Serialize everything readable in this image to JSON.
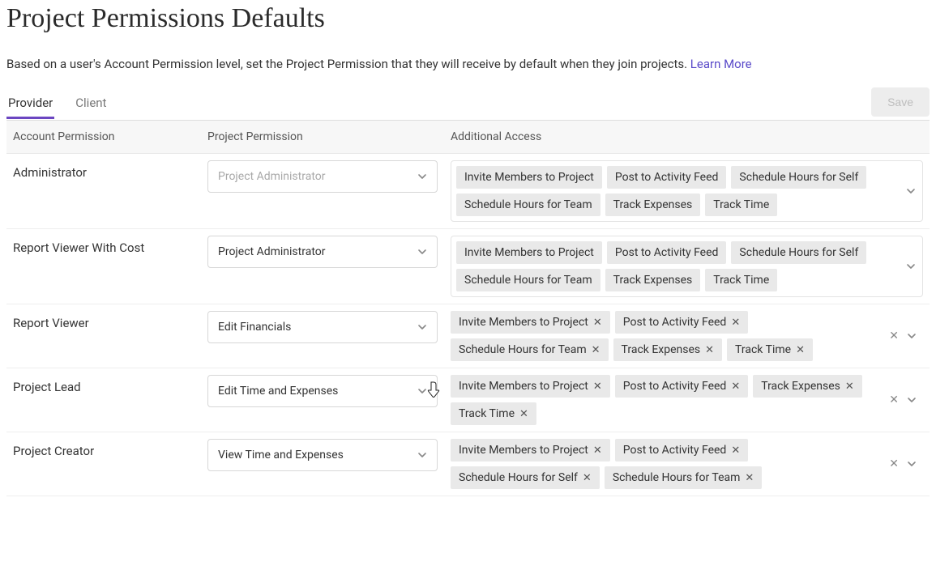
{
  "title": "Project Permissions Defaults",
  "desc": "Based on a user's Account Permission level, set the Project Permission that they will receive by default when they join projects. ",
  "learn_more": "Learn More",
  "tabs": {
    "provider": "Provider",
    "client": "Client"
  },
  "save": "Save",
  "columns": {
    "account": "Account Permission",
    "project": "Project Permission",
    "access": "Additional Access"
  },
  "rows": [
    {
      "account": "Administrator",
      "project_value": "Project Administrator",
      "project_is_placeholder": true,
      "tags_in_box": true,
      "show_clear": false,
      "removable": false,
      "tags": [
        "Invite Members to Project",
        "Post to Activity Feed",
        "Schedule Hours for Self",
        "Schedule Hours for Team",
        "Track Expenses",
        "Track Time"
      ]
    },
    {
      "account": "Report Viewer With Cost",
      "project_value": "Project Administrator",
      "project_is_placeholder": false,
      "tags_in_box": true,
      "show_clear": false,
      "removable": false,
      "tags": [
        "Invite Members to Project",
        "Post to Activity Feed",
        "Schedule Hours for Self",
        "Schedule Hours for Team",
        "Track Expenses",
        "Track Time"
      ]
    },
    {
      "account": "Report Viewer",
      "project_value": "Edit Financials",
      "project_is_placeholder": false,
      "tags_in_box": false,
      "show_clear": true,
      "removable": true,
      "tags": [
        "Invite Members to Project",
        "Post to Activity Feed",
        "Schedule Hours for Team",
        "Track Expenses",
        "Track Time"
      ]
    },
    {
      "account": "Project Lead",
      "project_value": "Edit Time and Expenses",
      "project_is_placeholder": false,
      "tags_in_box": false,
      "show_clear": true,
      "removable": true,
      "tags": [
        "Invite Members to Project",
        "Post to Activity Feed",
        "Track Expenses",
        "Track Time"
      ]
    },
    {
      "account": "Project Creator",
      "project_value": "View Time and Expenses",
      "project_is_placeholder": false,
      "tags_in_box": false,
      "show_clear": true,
      "removable": true,
      "tags": [
        "Invite Members to Project",
        "Post to Activity Feed",
        "Schedule Hours for Self",
        "Schedule Hours for Team"
      ]
    }
  ]
}
